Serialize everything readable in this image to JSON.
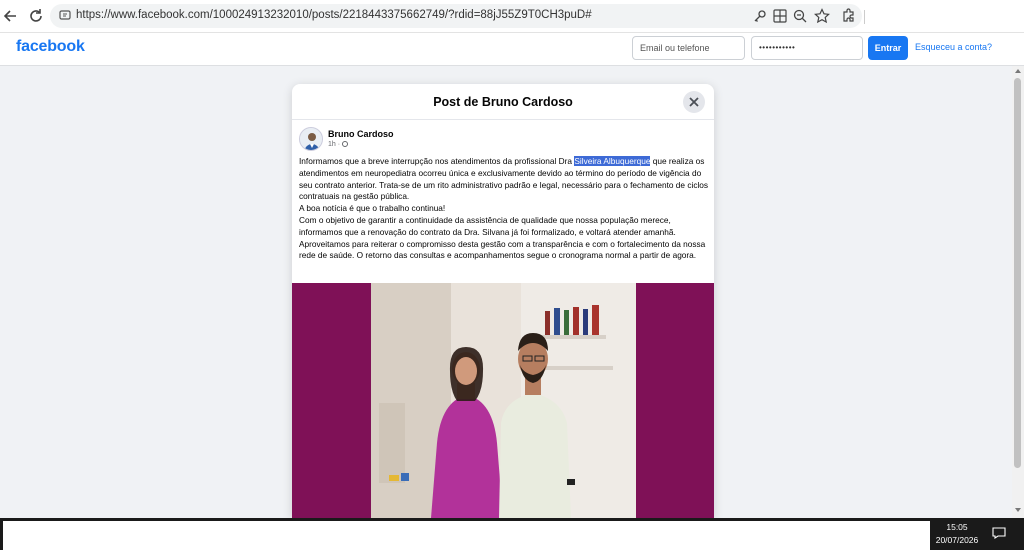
{
  "browser": {
    "url": "https://www.facebook.com/100024913232010/posts/2218443375662749/?rdid=88jJ55Z9T0CH3puD#"
  },
  "fb_header": {
    "logo": "facebook",
    "email_placeholder": "Email ou telefone",
    "password_value": "•••••••••••",
    "login_label": "Entrar",
    "forgot_label": "Esqueceu a conta?"
  },
  "modal": {
    "title": "Post de Bruno Cardoso",
    "author": "Bruno Cardoso",
    "time": "1h ·",
    "text_p1_before": "Informamos que a breve interrupção nos atendimentos da profissional Dra ",
    "text_p1_highlight": "Silveira Albuquerque",
    "text_p1_after": " que realiza os atendimentos em neuropediatra ocorreu única e exclusivamente devido ao término do período de vigência do seu contrato anterior. Trata-se de um rito administrativo padrão e legal, necessário para o fechamento de ciclos contratuais na gestão pública.",
    "text_p2": "A boa notícia é que o trabalho continua!",
    "text_p3": "Com o objetivo de garantir a continuidade da assistência de qualidade que nossa população merece, informamos que a renovação do contrato da Dra. Silvana já foi formalizado, e voltará atender amanhã. Aproveitamos para reiterar o compromisso desta gestão com a transparência e com o fortalecimento da nossa rede de saúde. O retorno das consultas e acompanhamentos segue o cronograma normal a partir de agora."
  },
  "taskbar": {
    "time": "15:05",
    "date": "20/07/2026"
  },
  "colors": {
    "fb_blue": "#1877f2",
    "photo_bg": "#7f1157",
    "highlight": "#3d6ad6"
  }
}
